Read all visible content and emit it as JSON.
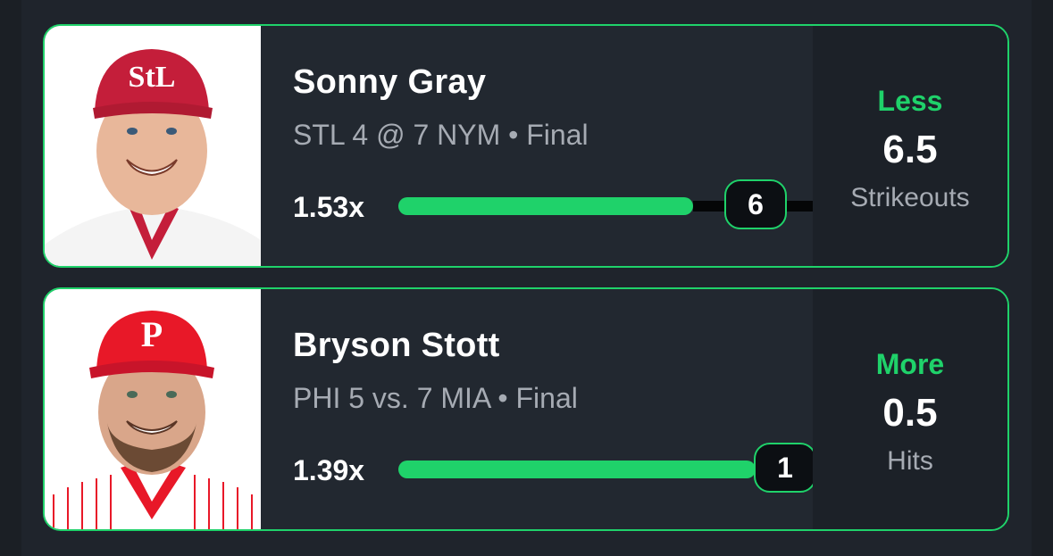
{
  "picks": [
    {
      "player": "Sonny Gray",
      "game": "STL 4 @ 7 NYM • Final",
      "multiplier": "1.53x",
      "result": "6",
      "progress": 0.857,
      "direction": "Less",
      "line": "6.5",
      "stat": "Strikeouts",
      "team_color": "#c41e3a",
      "cap_logo_icon": "stl-logo-icon"
    },
    {
      "player": "Bryson Stott",
      "game": "PHI 5 vs. 7 MIA • Final",
      "multiplier": "1.39x",
      "result": "1",
      "progress": 1.0,
      "direction": "More",
      "line": "0.5",
      "stat": "Hits",
      "team_color": "#e81828",
      "cap_logo_icon": "phi-logo-icon"
    }
  ]
}
